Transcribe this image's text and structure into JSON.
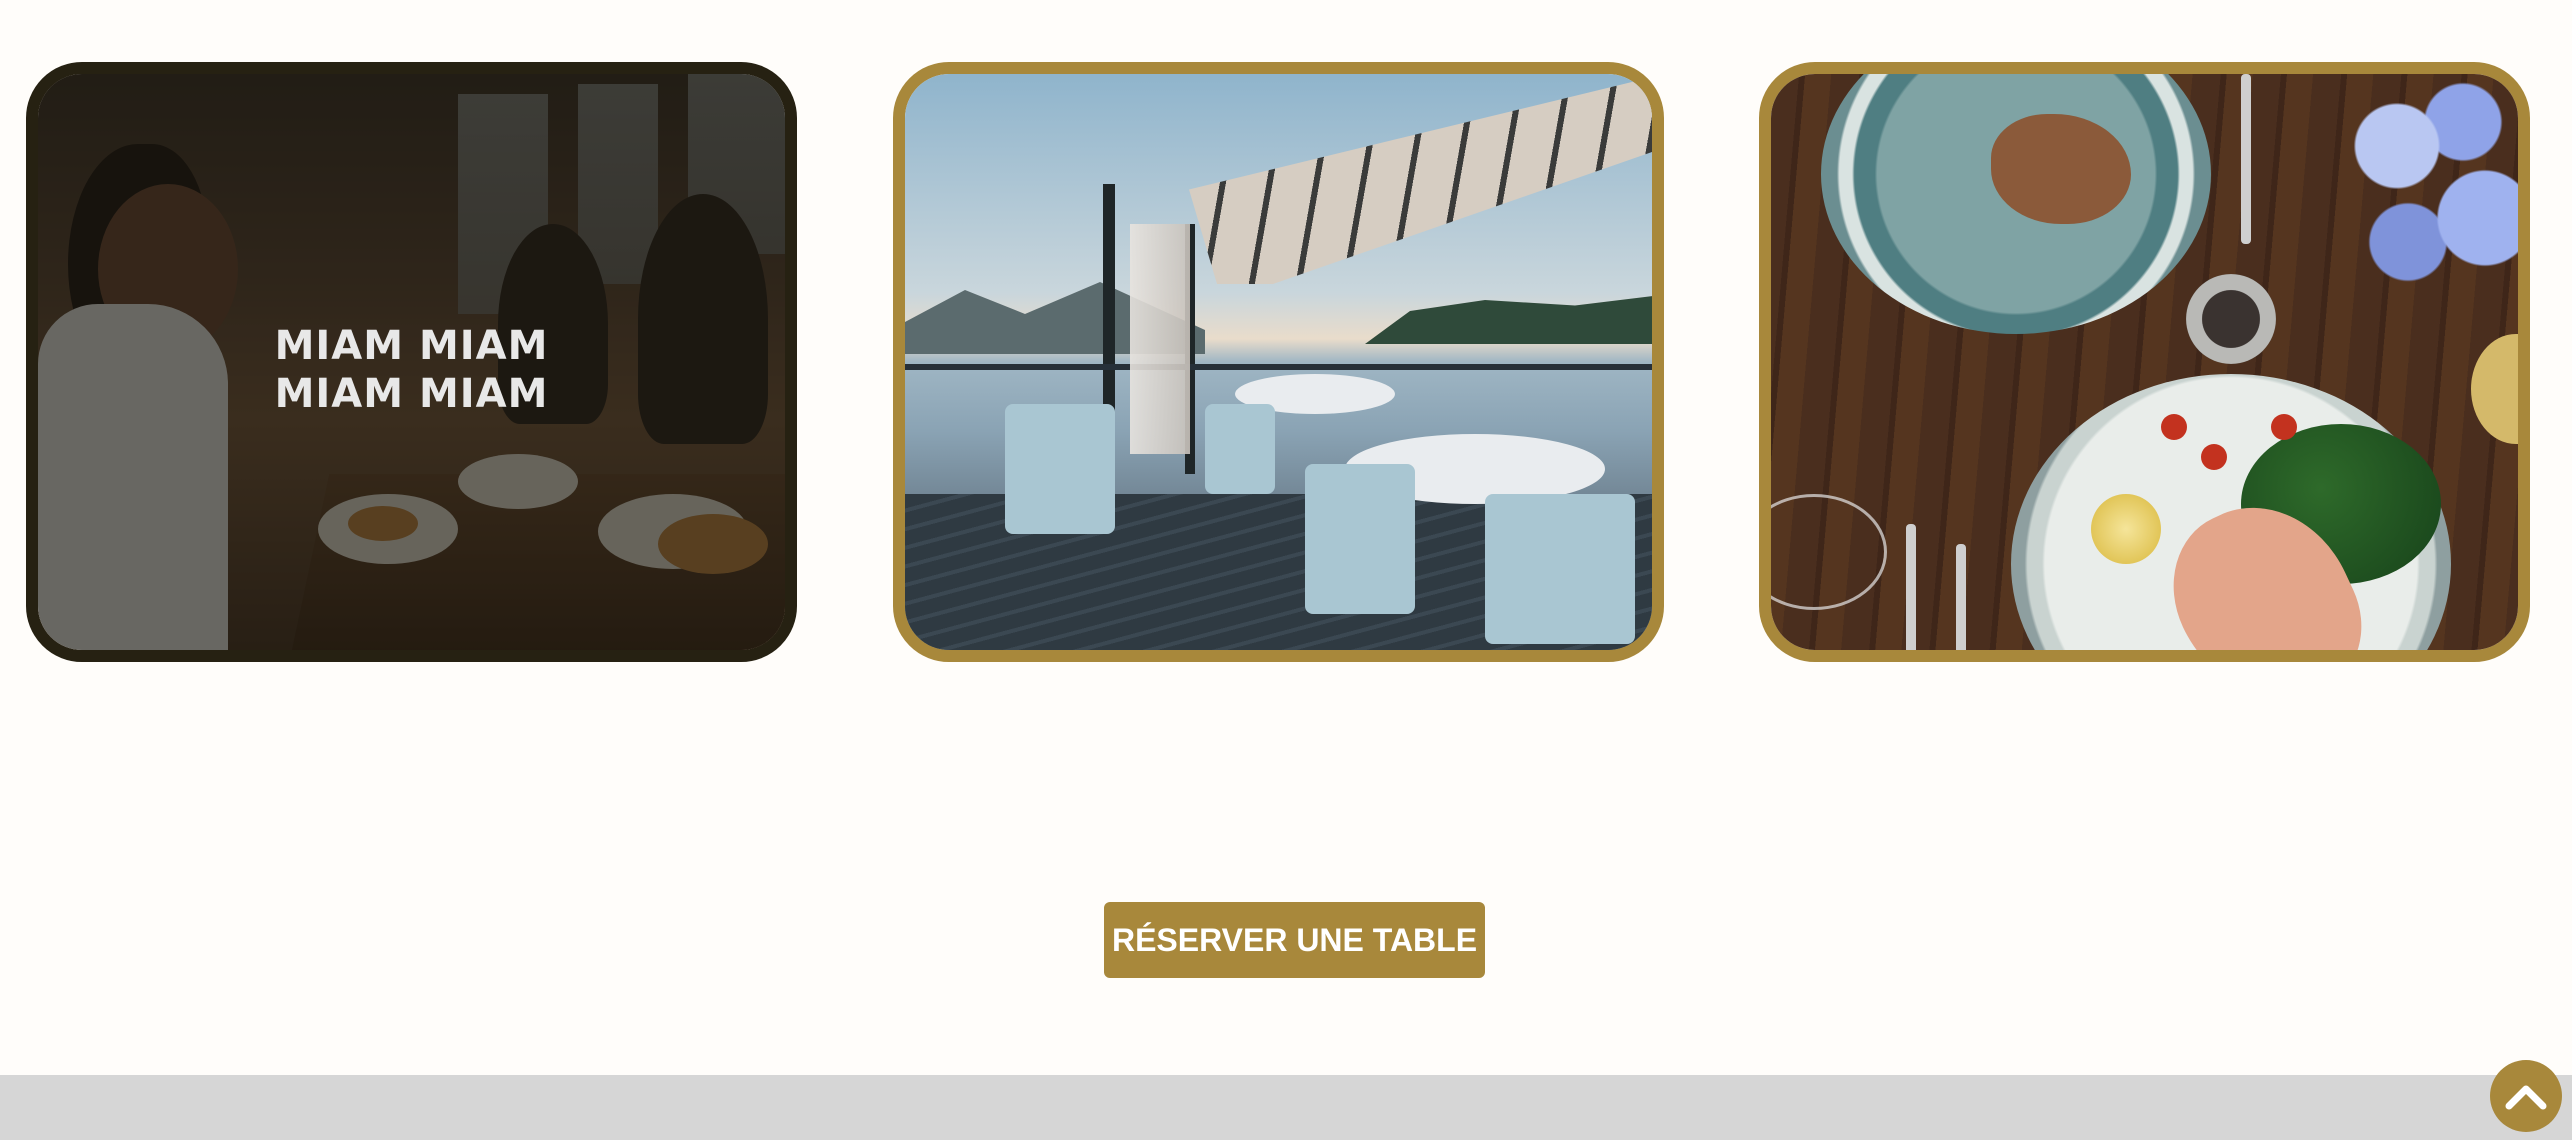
{
  "gallery": {
    "cards": [
      {
        "caption": "MIAM MIAM MIAM MIAM"
      },
      {
        "caption": ""
      },
      {
        "caption": ""
      }
    ]
  },
  "cta": {
    "label": "RÉSERVER UNE TABLE"
  },
  "colors": {
    "accent_gold": "#a8883b",
    "hover_overlay": "#14110c",
    "footer_bg": "#d6d6d6",
    "page_bg": "#fffdfa"
  },
  "icons": {
    "scroll_top": "chevron-up-icon"
  }
}
